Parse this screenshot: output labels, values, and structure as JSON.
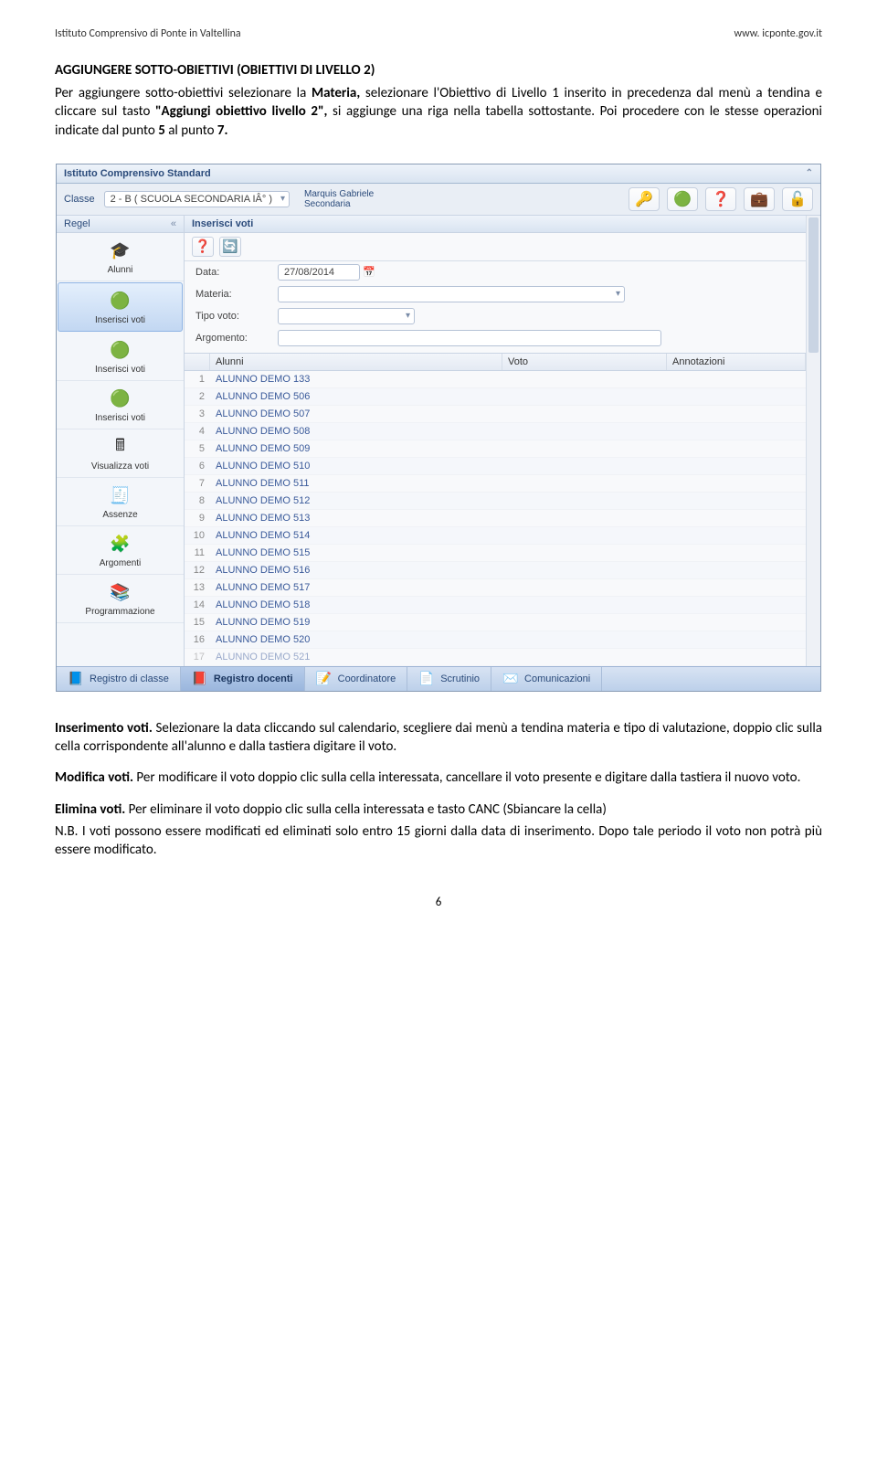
{
  "header": {
    "left": "Istituto Comprensivo di Ponte in Valtellina",
    "right": "www. icponte.gov.it"
  },
  "section_title": "AGGIUNGERE SOTTO-OBIETTIVI (OBIETTIVI DI LIVELLO 2)",
  "para1_a": "Per aggiungere sotto-obiettivi selezionare la ",
  "para1_b": "Materia, ",
  "para1_c": "selezionare l'Obiettivo di Livello 1 inserito in precedenza dal menù a tendina e cliccare sul tasto ",
  "para1_d": "\"Aggiungi obiettivo livello 2\", ",
  "para1_e": "si aggiunge una riga nella tabella sottostante. Poi procedere con le stesse operazioni indicate dal punto ",
  "para1_f": "5 ",
  "para1_g": "al punto ",
  "para1_h": "7.",
  "app": {
    "title": "Istituto Comprensivo Standard",
    "classe_label": "Classe",
    "classe_value": "2 - B ( SCUOLA SECONDARIA IÂ° )",
    "user_line1": "Marquis Gabriele",
    "user_line2": "Secondaria",
    "toolbar_icons": [
      "🔑",
      "🟢",
      "❓",
      "💼",
      "🔓"
    ],
    "sidebar_header": "Regel",
    "sidebar_items": [
      {
        "icon": "🎓",
        "label": "Alunni"
      },
      {
        "icon": "🟢",
        "label": "Inserisci voti"
      },
      {
        "icon": "🟢",
        "label": "Inserisci voti"
      },
      {
        "icon": "🟢",
        "label": "Inserisci voti"
      },
      {
        "icon": "🖩",
        "label": "Visualizza voti"
      },
      {
        "icon": "🧾",
        "label": "Assenze"
      },
      {
        "icon": "🧩",
        "label": "Argomenti"
      },
      {
        "icon": "📚",
        "label": "Programmazione"
      }
    ],
    "panel_title": "Inserisci voti",
    "panel_icons": [
      "❓",
      "🔄"
    ],
    "form": {
      "data_label": "Data:",
      "data_value": "27/08/2014",
      "materia_label": "Materia:",
      "tipo_label": "Tipo voto:",
      "argomento_label": "Argomento:"
    },
    "grid_cols": {
      "num": "",
      "alunni": "Alunni",
      "voto": "Voto",
      "ann": "Annotazioni"
    },
    "rows": [
      {
        "n": "1",
        "name": "ALUNNO DEMO 133"
      },
      {
        "n": "2",
        "name": "ALUNNO DEMO 506"
      },
      {
        "n": "3",
        "name": "ALUNNO DEMO 507"
      },
      {
        "n": "4",
        "name": "ALUNNO DEMO 508"
      },
      {
        "n": "5",
        "name": "ALUNNO DEMO 509"
      },
      {
        "n": "6",
        "name": "ALUNNO DEMO 510"
      },
      {
        "n": "7",
        "name": "ALUNNO DEMO 511"
      },
      {
        "n": "8",
        "name": "ALUNNO DEMO 512"
      },
      {
        "n": "9",
        "name": "ALUNNO DEMO 513"
      },
      {
        "n": "10",
        "name": "ALUNNO DEMO 514"
      },
      {
        "n": "11",
        "name": "ALUNNO DEMO 515"
      },
      {
        "n": "12",
        "name": "ALUNNO DEMO 516"
      },
      {
        "n": "13",
        "name": "ALUNNO DEMO 517"
      },
      {
        "n": "14",
        "name": "ALUNNO DEMO 518"
      },
      {
        "n": "15",
        "name": "ALUNNO DEMO 519"
      },
      {
        "n": "16",
        "name": "ALUNNO DEMO 520"
      },
      {
        "n": "17",
        "name": "ALUNNO DEMO 521"
      }
    ],
    "bottom_tabs": [
      {
        "icon": "📘",
        "label": "Registro di classe"
      },
      {
        "icon": "📕",
        "label": "Registro docenti"
      },
      {
        "icon": "📝",
        "label": "Coordinatore"
      },
      {
        "icon": "📄",
        "label": "Scrutinio"
      },
      {
        "icon": "✉️",
        "label": "Comunicazioni"
      }
    ]
  },
  "p_inserimento_head": "Inserimento voti.",
  "p_inserimento_body": " Selezionare la data cliccando sul calendario, scegliere dai menù a tendina materia e tipo di valutazione, doppio clic sulla cella corrispondente all'alunno e dalla tastiera digitare il voto.",
  "p_modifica_head": "Modifica voti.",
  "p_modifica_body": " Per modificare il voto doppio clic sulla cella interessata, cancellare il voto presente e digitare dalla tastiera il nuovo voto.",
  "p_elimina_head": "Elimina voti.",
  "p_elimina_body": " Per eliminare il voto doppio clic sulla cella interessata e tasto CANC (Sbiancare la cella)",
  "p_nb": "N.B. I voti possono essere modificati ed eliminati solo entro 15 giorni dalla data di inserimento. Dopo tale periodo il voto non potrà più essere modificato.",
  "page_number": "6"
}
